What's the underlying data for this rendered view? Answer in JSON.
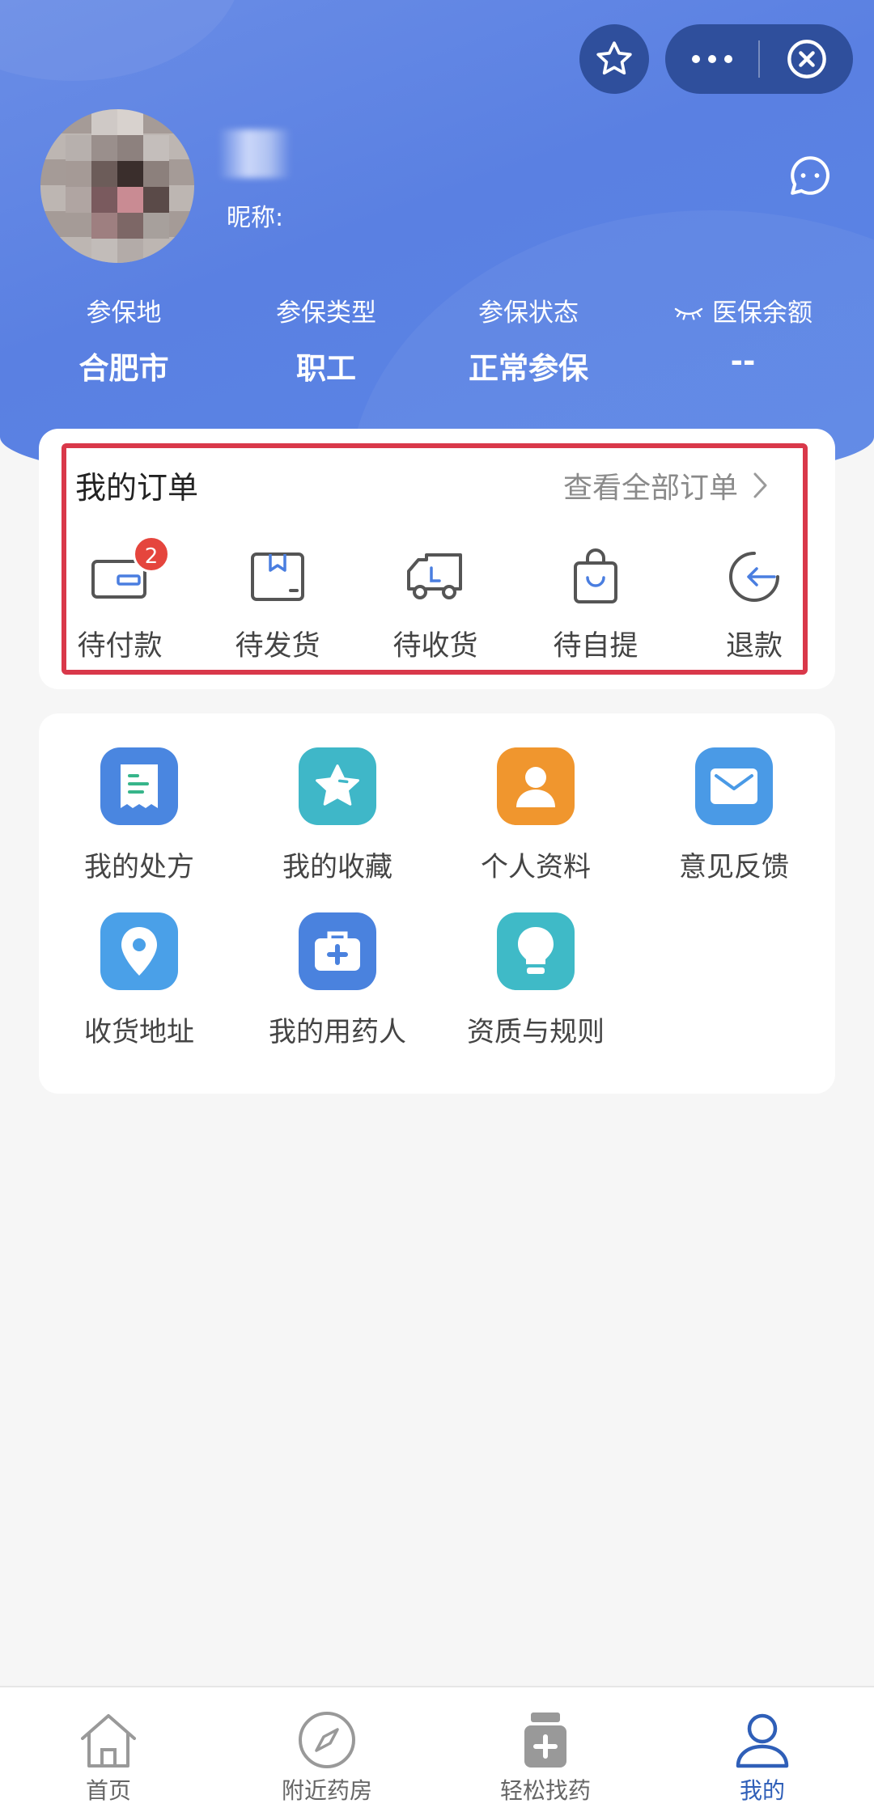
{
  "header": {
    "nickname_label": "昵称:",
    "insurance": [
      {
        "label": "参保地",
        "value": "合肥市"
      },
      {
        "label": "参保类型",
        "value": "职工"
      },
      {
        "label": "参保状态",
        "value": "正常参保"
      },
      {
        "label": "医保余额",
        "value": "--"
      }
    ]
  },
  "orders": {
    "title": "我的订单",
    "view_all": "查看全部订单",
    "items": [
      {
        "label": "待付款",
        "icon": "wallet-icon",
        "badge": "2"
      },
      {
        "label": "待发货",
        "icon": "box-icon"
      },
      {
        "label": "待收货",
        "icon": "truck-icon"
      },
      {
        "label": "待自提",
        "icon": "bag-icon"
      },
      {
        "label": "退款",
        "icon": "refund-icon"
      }
    ]
  },
  "tools": [
    {
      "label": "我的处方",
      "icon": "prescription-icon",
      "color": "#4a86e0"
    },
    {
      "label": "我的收藏",
      "icon": "star-icon",
      "color": "#3fb7c8"
    },
    {
      "label": "个人资料",
      "icon": "person-icon",
      "color": "#f0962e"
    },
    {
      "label": "意见反馈",
      "icon": "mail-icon",
      "color": "#4a9ae6"
    },
    {
      "label": "收货地址",
      "icon": "location-icon",
      "color": "#4aa0e8"
    },
    {
      "label": "我的用药人",
      "icon": "medkit-icon",
      "color": "#4a82de"
    },
    {
      "label": "资质与规则",
      "icon": "bulb-icon",
      "color": "#3fbac7"
    }
  ],
  "tabbar": [
    {
      "label": "首页",
      "icon": "home-icon"
    },
    {
      "label": "附近药房",
      "icon": "compass-icon"
    },
    {
      "label": "轻松找药",
      "icon": "medicine-bottle-icon"
    },
    {
      "label": "我的",
      "icon": "user-icon",
      "active": true
    }
  ],
  "colors": {
    "header_blue": "#5a80e2",
    "capsule": "#2f4f9c",
    "highlight_red": "#d9384a",
    "badge_red": "#e5453d",
    "tab_active": "#2f5fb8"
  }
}
